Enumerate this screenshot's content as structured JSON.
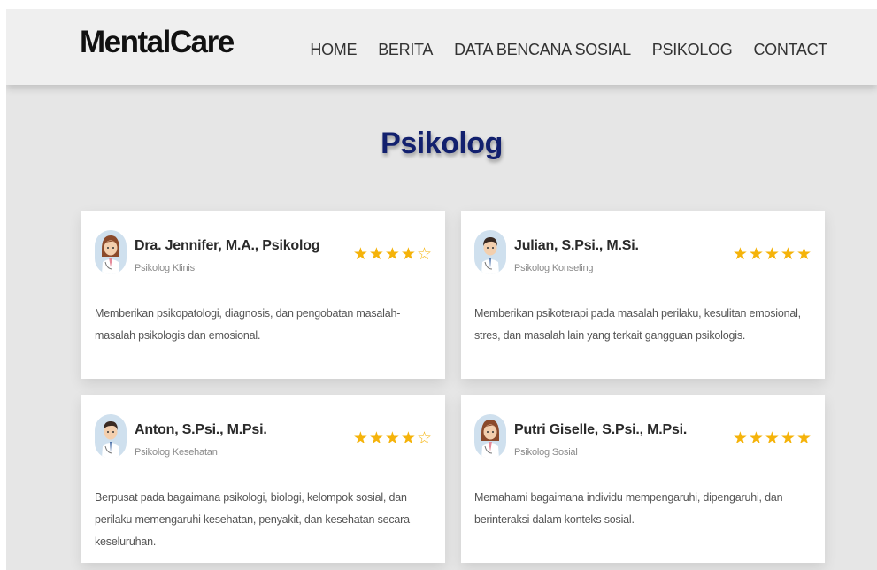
{
  "brand": "MentalCare",
  "nav": {
    "items": [
      {
        "label": "HOME"
      },
      {
        "label": "BERITA"
      },
      {
        "label": "DATA BENCANA SOSIAL"
      },
      {
        "label": "PSIKOLOG"
      },
      {
        "label": "CONTACT"
      }
    ]
  },
  "section_title": "Psikolog",
  "colors": {
    "title": "#12206e",
    "star": "#f5b30a",
    "page_bg": "#e6e6e6",
    "card_bg": "#ffffff"
  },
  "psychologists": [
    {
      "name": "Dra. Jennifer, M.A., Psikolog",
      "role": "Psikolog Klinis",
      "rating": 4,
      "rating_max": 5,
      "rating_stars": "★★★★☆",
      "avatar": "female-doctor-avatar",
      "description": "Memberikan psikopatologi, diagnosis, dan pengobatan masalah-masalah psikologis dan emosional."
    },
    {
      "name": "Julian, S.Psi., M.Si.",
      "role": "Psikolog Konseling",
      "rating": 5,
      "rating_max": 5,
      "rating_stars": "★★★★★",
      "avatar": "male-doctor-avatar",
      "description": "Memberikan psikoterapi pada masalah perilaku, kesulitan emosional, stres, dan masalah lain yang terkait gangguan psikologis."
    },
    {
      "name": "Anton, S.Psi., M.Psi.",
      "role": "Psikolog Kesehatan",
      "rating": 4,
      "rating_max": 5,
      "rating_stars": "★★★★☆",
      "avatar": "male-doctor-avatar",
      "description": "Berpusat pada bagaimana psikologi, biologi, kelompok sosial, dan perilaku memengaruhi kesehatan, penyakit, dan kesehatan secara keseluruhan."
    },
    {
      "name": "Putri Giselle, S.Psi., M.Psi.",
      "role": "Psikolog Sosial",
      "rating": 5,
      "rating_max": 5,
      "rating_stars": "★★★★★",
      "avatar": "female-doctor-avatar",
      "description": "Memahami bagaimana individu mempengaruhi, dipengaruhi, dan berinteraksi dalam konteks sosial."
    }
  ]
}
